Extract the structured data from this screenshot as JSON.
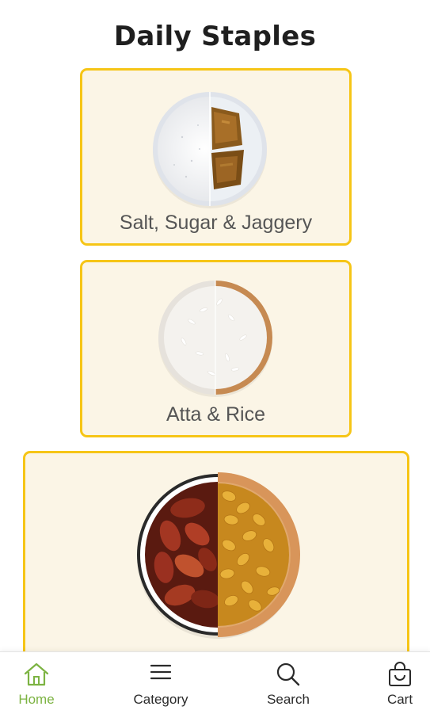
{
  "header": {
    "title": "Daily Staples"
  },
  "categories": [
    {
      "label": "Salt, Sugar & Jaggery",
      "image": "salt-sugar-jaggery-bowl"
    },
    {
      "label": "Atta & Rice",
      "image": "atta-rice-bowl"
    },
    {
      "label": "",
      "image": "dates-raisins-bowl"
    }
  ],
  "bottom_nav": {
    "items": [
      {
        "label": "Home",
        "icon": "home-icon",
        "active": true
      },
      {
        "label": "Category",
        "icon": "menu-icon"
      },
      {
        "label": "Search",
        "icon": "search-icon"
      },
      {
        "label": "Cart",
        "icon": "cart-icon"
      }
    ]
  },
  "colors": {
    "card_border": "#f6c516",
    "card_background": "#fbf5e6",
    "active_nav": "#7cb342"
  }
}
